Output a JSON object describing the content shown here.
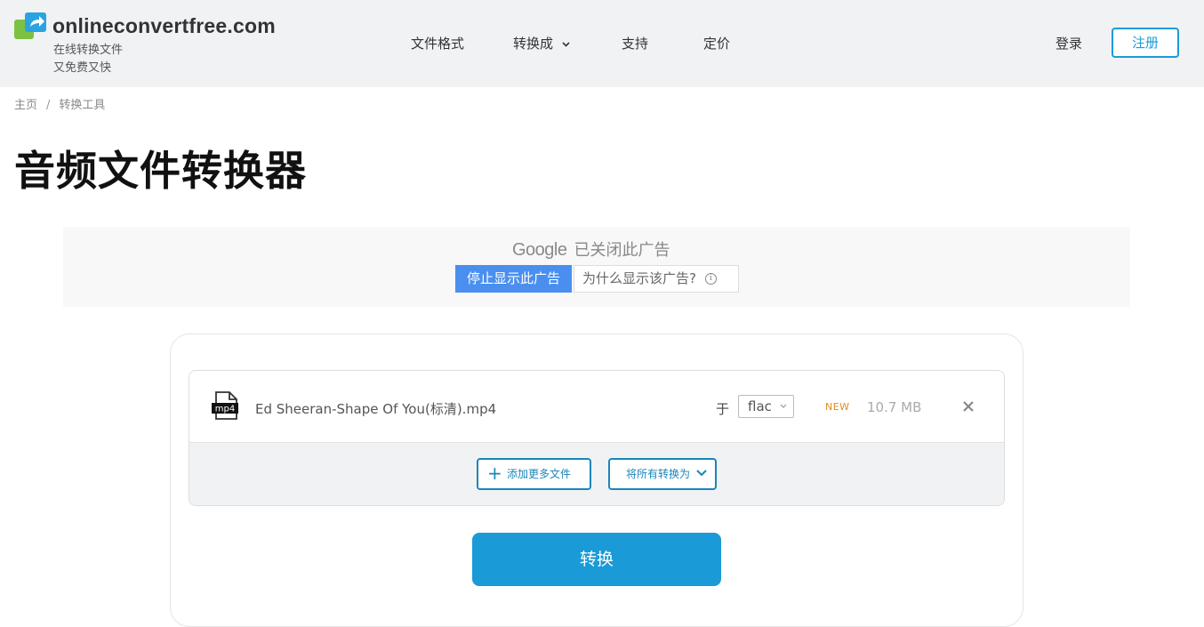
{
  "header": {
    "site_name": "onlineconvertfree.com",
    "tagline_line1": "在线转换文件",
    "tagline_line2": "又免费又快",
    "logo_icon": "file-convert-arrow-icon",
    "nav": {
      "formats": "文件格式",
      "convert_to": "转换成",
      "support": "支持",
      "pricing": "定价"
    },
    "login": "登录",
    "register": "注册"
  },
  "breadcrumb": {
    "home": "主页",
    "separator": "/",
    "current": "转换工具"
  },
  "page_title": "音频文件转换器",
  "ad": {
    "brand": "Google",
    "closed_text": "已关闭此广告",
    "stop_button": "停止显示此广告",
    "why_button": "为什么显示该广告?",
    "info_symbol": "i"
  },
  "converter": {
    "file": {
      "icon_label": "mp4",
      "name": "Ed Sheeran-Shape Of You(标清).mp4",
      "to_label": "于",
      "target_format": "flac",
      "badge": "NEW",
      "size": "10.7 MB"
    },
    "add_more": "添加更多文件",
    "add_more_symbol": "+",
    "convert_all": "将所有转换为",
    "convert_button": "转换"
  },
  "colors": {
    "accent": "#1a9bd7",
    "header_bg": "#f1f2f4",
    "new_badge": "#e58a1f",
    "ad_stop_bg": "#4a8fef"
  }
}
